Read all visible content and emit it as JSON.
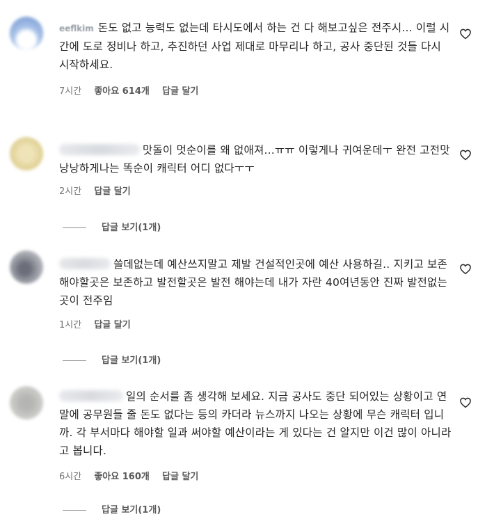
{
  "comments": [
    {
      "username": "eeflkim",
      "text": "돈도 없고 능력도 없는데 타시도에서 하는 건 다 해보고싶은 전주시... 이럴 시간에 도로 정비나 하고, 추진하던 사업 제대로 마무리나 하고, 공사 중단된 것들 다시 시작하세요.",
      "time": "7시간",
      "likes": "좋아요 614개",
      "reply_label": "답글 달기",
      "view_replies": ""
    },
    {
      "username": "",
      "text": "맛돌이 멋순이를 왜 없애져...ㅠㅠ 이렇게나 귀여운데ㅜ 완전 고전맛 낭낭하게나는 똑순이 캐릭터 어디 없다ㅜㅜ",
      "time": "2시간",
      "likes": "",
      "reply_label": "답글 달기",
      "view_replies": "답글 보기(1개)"
    },
    {
      "username": "",
      "text": "쓸데없는데 예산쓰지말고 제발 건설적인곳에 예산 사용하길.. 지키고 보존해야할곳은 보존하고 발전할곳은 발전 해야는데 내가 자란 40여년동안 진짜 발전없는곳이 전주임",
      "time": "1시간",
      "likes": "",
      "reply_label": "답글 달기",
      "view_replies": "답글 보기(1개)"
    },
    {
      "username": "",
      "text": "일의 순서를 좀 생각해 보세요. 지금 공사도 중단 되어있는 상황이고 연말에 공무원들 줄 돈도 없다는 등의 카더라 뉴스까지 나오는 상황에 무슨 캐릭터 입니까. 각 부서마다 해야할 일과 써야할 예산이라는 게 있다는 건 알지만 이건 많이 아니라고 봅니다.",
      "time": "6시간",
      "likes": "좋아요 160개",
      "reply_label": "답글 달기",
      "view_replies": "답글 보기(1개)"
    }
  ],
  "icons": {
    "like": "heart-outline-icon"
  },
  "colors": {
    "text": "#262626",
    "meta": "#737373"
  }
}
